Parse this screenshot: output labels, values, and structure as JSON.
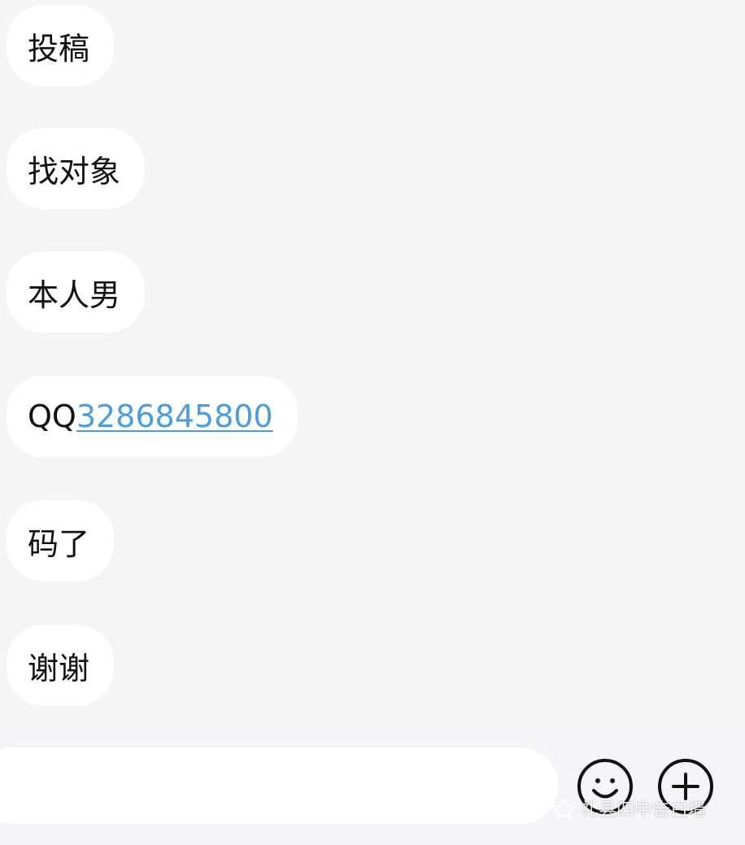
{
  "messages": [
    {
      "text": "投稿"
    },
    {
      "text": "找对象"
    },
    {
      "text": "本人男"
    },
    {
      "prefix": "QQ",
      "link": "3286845800"
    },
    {
      "text": "码了"
    },
    {
      "text": "谢谢"
    }
  ],
  "input": {
    "placeholder": ""
  },
  "toolbar": {
    "emoji_icon": "smiley-face-icon",
    "plus_icon": "plus-circle-icon"
  },
  "watermark": {
    "text": "礼县四中告白墙"
  },
  "colors": {
    "background": "#f5f5f7",
    "bubble": "#ffffff",
    "link": "#4a9de0",
    "text": "#111111"
  }
}
